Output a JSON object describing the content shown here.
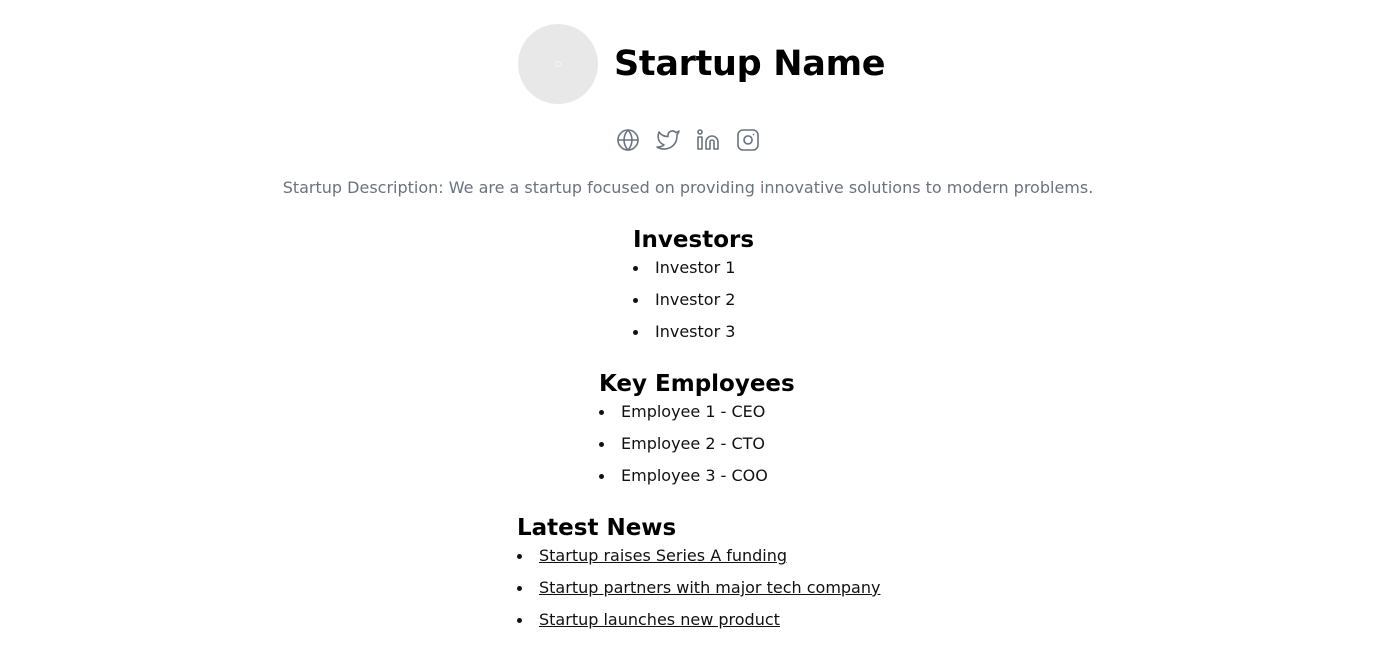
{
  "header": {
    "startup_name": "Startup Name"
  },
  "social_links": [
    {
      "icon": "globe-icon"
    },
    {
      "icon": "twitter-icon"
    },
    {
      "icon": "linkedin-icon"
    },
    {
      "icon": "instagram-icon"
    }
  ],
  "description": "Startup Description: We are a startup focused on providing innovative solutions to modern problems.",
  "investors": {
    "title": "Investors",
    "items": [
      "Investor 1",
      "Investor 2",
      "Investor 3"
    ]
  },
  "employees": {
    "title": "Key Employees",
    "items": [
      "Employee 1 - CEO",
      "Employee 2 - CTO",
      "Employee 3 - COO"
    ]
  },
  "news": {
    "title": "Latest News",
    "items": [
      "Startup raises Series A funding",
      "Startup partners with major tech company",
      "Startup launches new product"
    ]
  },
  "colors": {
    "icon": "#6b7280",
    "description": "#6b7280",
    "logo_bg": "#e8e8e8"
  }
}
